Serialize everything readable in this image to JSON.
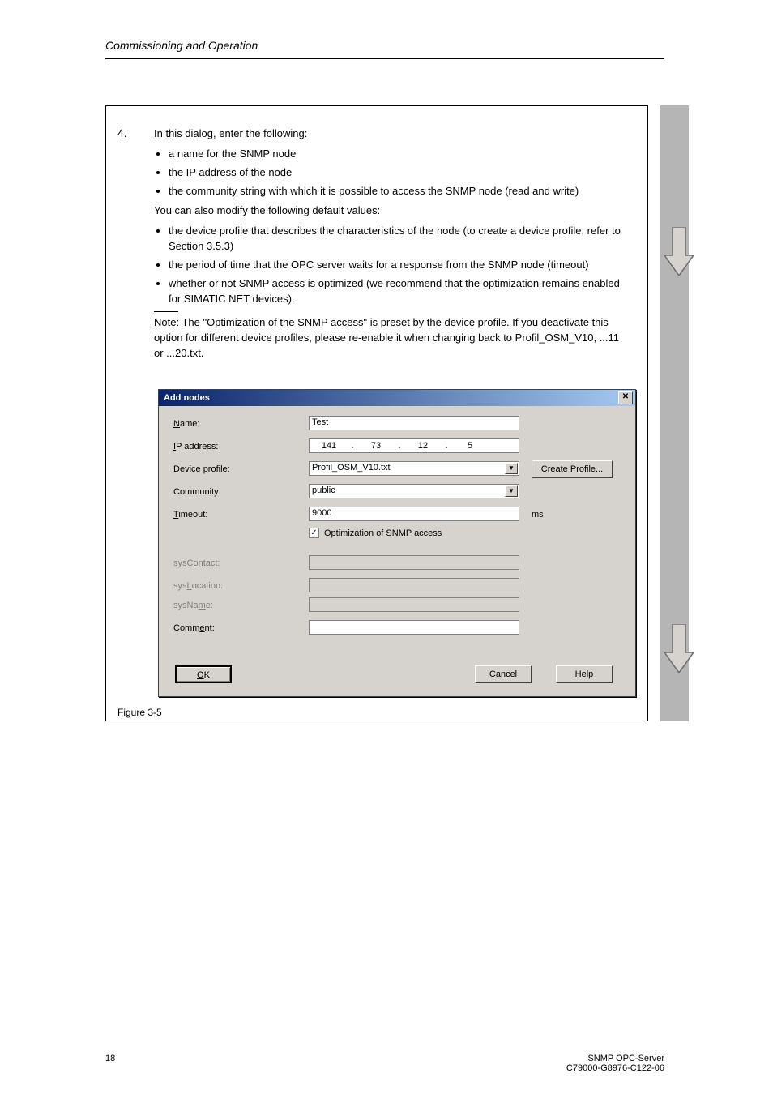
{
  "header": {
    "left_italic": "Commissioning and Operation"
  },
  "step": {
    "number": "4.",
    "intro": "In this dialog, enter the following:",
    "bullets_a": [
      "a name for the SNMP node",
      "the IP address of the node",
      "the community string with which it is possible to access the SNMP node (read and write)"
    ],
    "then": "You can also modify the following default values:",
    "bullets_b": [
      "the device profile that describes the characteristics of the node (to create a device profile, refer to Section 3.5.3)",
      "the period of time that the OPC server waits for a response from the SNMP node (timeout)",
      "whether or not SNMP access is optimized (we recommend that the optimization remains enabled for SIMATIC NET devices)."
    ],
    "note": "Note: The \"Optimization of the SNMP access\" is preset by the device profile. If you deactivate this option for different device profiles, please re-enable it when changing back to Profil_OSM_V10, ...11 or ...20.txt."
  },
  "figure_caption": "Figure 3-5",
  "footer": {
    "page": "18",
    "right1": "SNMP OPC-Server",
    "right2": "C79000-G8976-C122-06"
  },
  "dialog": {
    "title": "Add nodes",
    "labels": {
      "name": "Name:",
      "ip": "IP address:",
      "profile": "Device profile:",
      "community": "Community:",
      "timeout": "Timeout:",
      "timeout_unit": "ms",
      "syscontact": "sysContact:",
      "syslocation": "sysLocation:",
      "sysname": "sysName:",
      "comment": "Comment:"
    },
    "values": {
      "name": "Test",
      "ip": [
        "141",
        "73",
        "12",
        "5"
      ],
      "profile": "Profil_OSM_V10.txt",
      "community": "public",
      "timeout": "9000",
      "opt_check": true,
      "opt_label": "Optimization of SNMP access",
      "syscontact": "",
      "syslocation": "",
      "sysname": "",
      "comment": ""
    },
    "buttons": {
      "create_profile": "Create Profile...",
      "ok": "OK",
      "cancel": "Cancel",
      "help": "Help"
    }
  }
}
